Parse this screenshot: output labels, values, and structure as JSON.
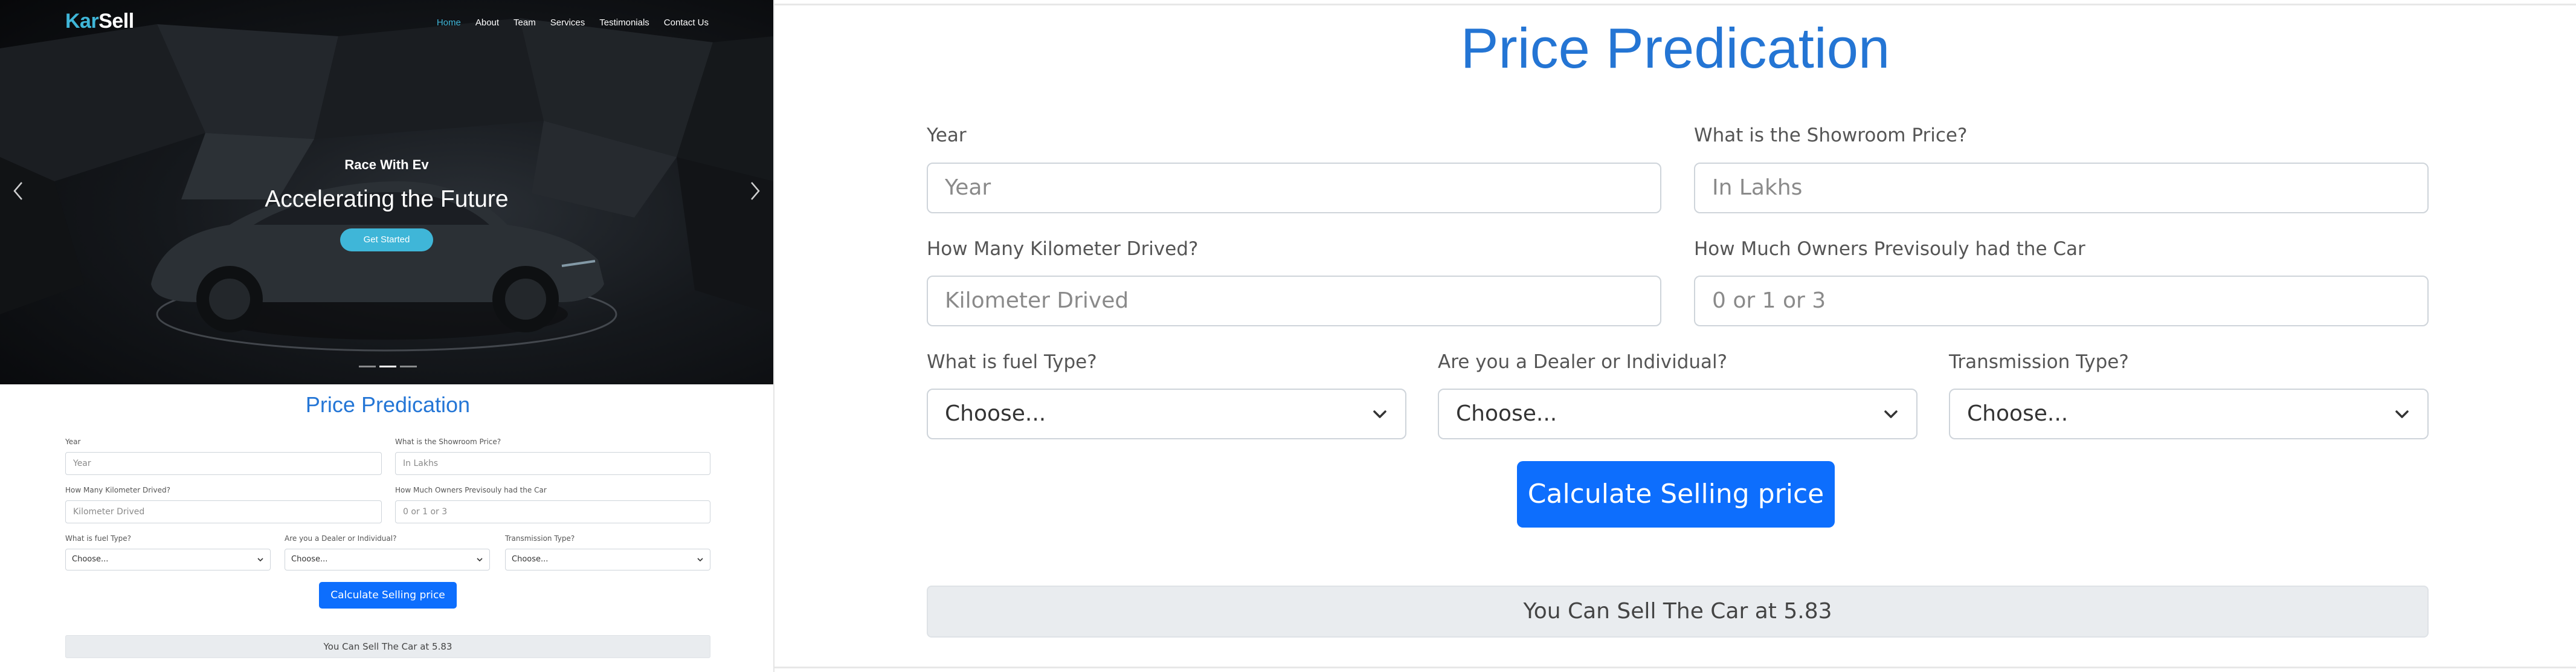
{
  "brand": {
    "part1": "Kar",
    "part2": "Sell"
  },
  "nav": {
    "items": [
      "Home",
      "About",
      "Team",
      "Services",
      "Testimonials",
      "Contact Us"
    ],
    "active": "Home"
  },
  "hero": {
    "subtitle": "Race With Ev",
    "title": "Accelerating the Future",
    "cta": "Get Started",
    "slides": 3,
    "active_slide": 2
  },
  "form": {
    "title": "Price Predication",
    "year": {
      "label": "Year",
      "placeholder": "Year"
    },
    "showroom_price": {
      "label": "What is the Showroom Price?",
      "placeholder": "In Lakhs"
    },
    "kms_driven": {
      "label": "How Many Kilometer Drived?",
      "placeholder": "Kilometer Drived"
    },
    "owners": {
      "label": "How Much Owners Previsouly had the Car",
      "placeholder": "0 or 1 or 3"
    },
    "fuel_type": {
      "label": "What is fuel Type?",
      "selected": "Choose..."
    },
    "seller_type": {
      "label": "Are you a Dealer or Individual?",
      "selected": "Choose..."
    },
    "transmission": {
      "label": "Transmission Type?",
      "selected": "Choose..."
    },
    "submit_label": "Calculate Selling price",
    "result": "You Can Sell The Car at 5.83"
  },
  "colors": {
    "accent": "#3fb6d8",
    "primary_button": "#0d6efd",
    "title_blue": "#2475d4",
    "result_bg": "#e9ecef"
  },
  "icons": [
    "chevron-left-icon",
    "chevron-right-icon",
    "chevron-down-icon"
  ]
}
